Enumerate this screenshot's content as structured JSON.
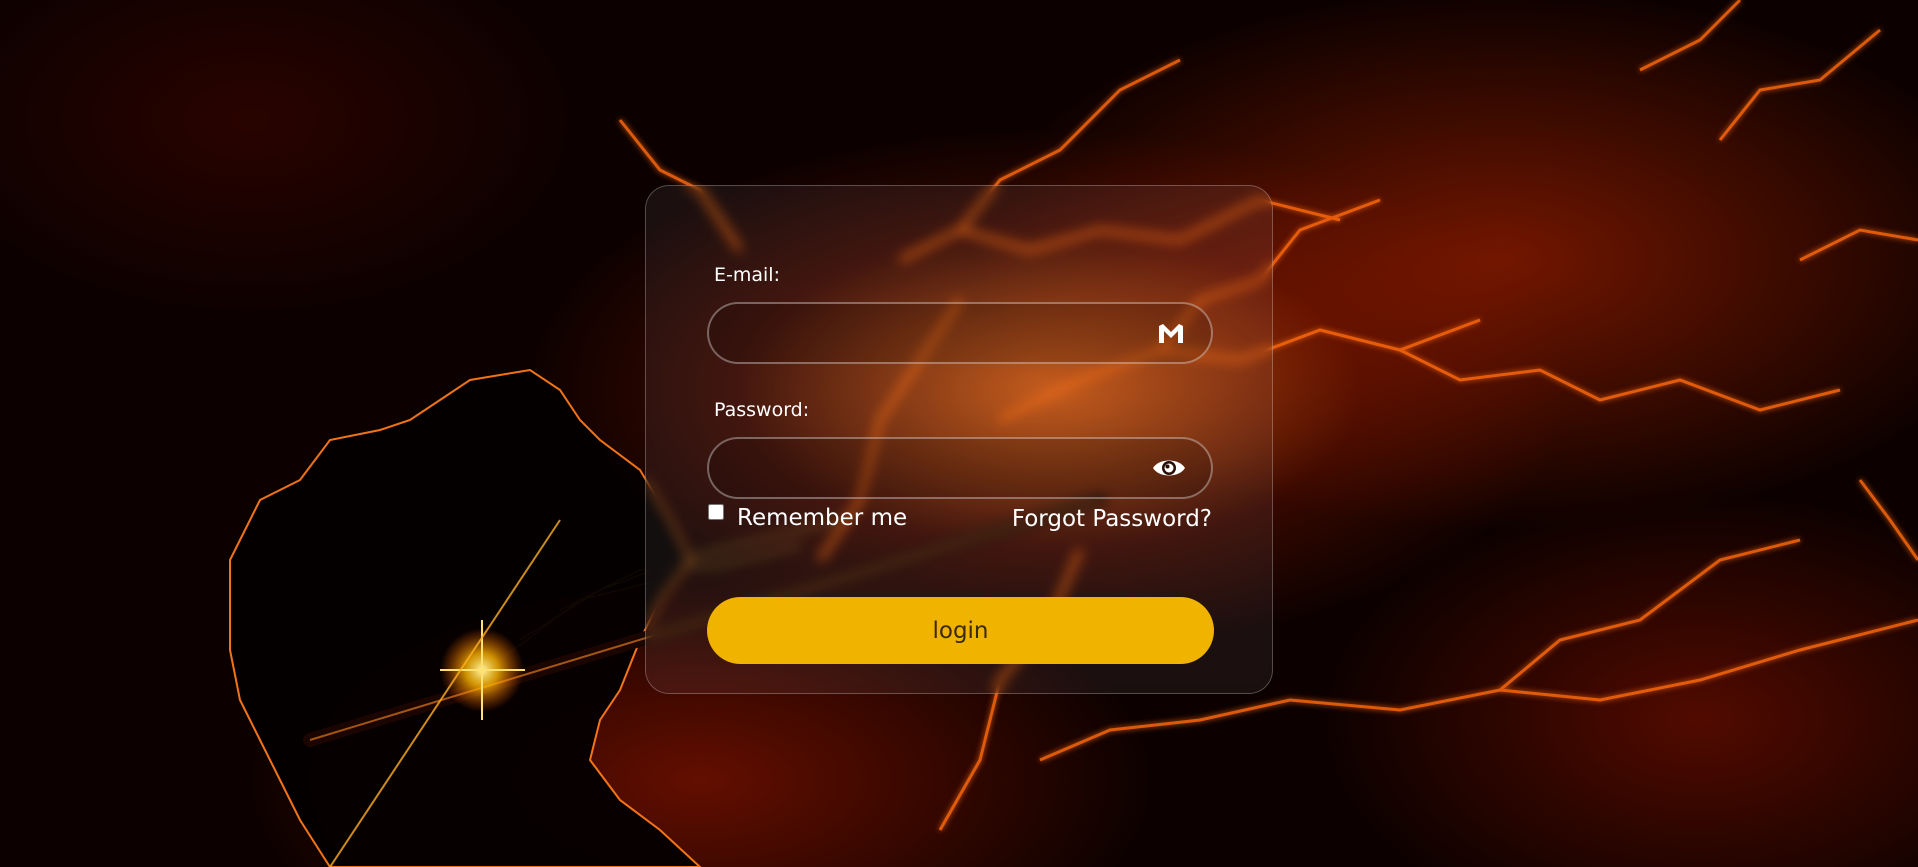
{
  "form": {
    "email_label": "E-mail:",
    "email_value": "",
    "email_icon": "gmail-icon",
    "password_label": "Password:",
    "password_value": "",
    "password_icon": "eye-icon",
    "remember_label": "Remember me",
    "remember_checked": false,
    "forgot_label": "Forgot Password?",
    "login_label": "login"
  },
  "colors": {
    "accent": "#f0b300",
    "text": "#ffffff",
    "background": "#0d0100",
    "glow": "#ff6a14"
  }
}
